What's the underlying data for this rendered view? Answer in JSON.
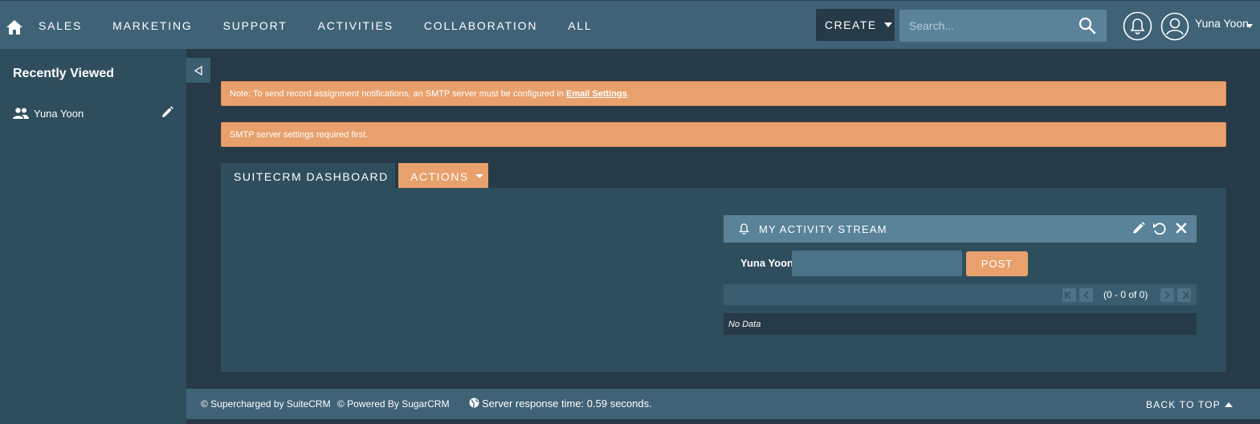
{
  "nav": {
    "links": [
      "SALES",
      "MARKETING",
      "SUPPORT",
      "ACTIVITIES",
      "COLLABORATION",
      "ALL"
    ],
    "create_label": "CREATE",
    "search_placeholder": "Search...",
    "user_name": "Yuna Yoon"
  },
  "sidebar": {
    "title": "Recently Viewed",
    "items": [
      {
        "label": "Yuna Yoon",
        "icon": "people-icon"
      }
    ]
  },
  "alerts": {
    "smtp_note_prefix": "Note: To send record assignment notifications, an SMTP server must be configured in",
    "smtp_note_link": "Email Settings",
    "smtp_note_suffix": ".",
    "smtp_required": "SMTP server settings required first."
  },
  "tabs": {
    "dashboard": "SUITECRM DASHBOARD",
    "actions": "ACTIONS"
  },
  "dashlet": {
    "title": "MY ACTIVITY STREAM",
    "post_user": "Yuna Yoon",
    "post_value": "",
    "post_button": "POST",
    "pagination": "(0 - 0 of 0)",
    "no_data": "No Data"
  },
  "footer": {
    "suitecrm": "© Supercharged by SuiteCRM",
    "sugarcrm": "© Powered By SugarCRM",
    "response_time": "Server response time: 0.59 seconds.",
    "back_to_top": "BACK TO TOP"
  },
  "colors": {
    "nav_bg": "#3f6277",
    "sidebar_bg": "#2f4e5d",
    "page_bg": "#263a47",
    "accent": "#e8a06c"
  }
}
